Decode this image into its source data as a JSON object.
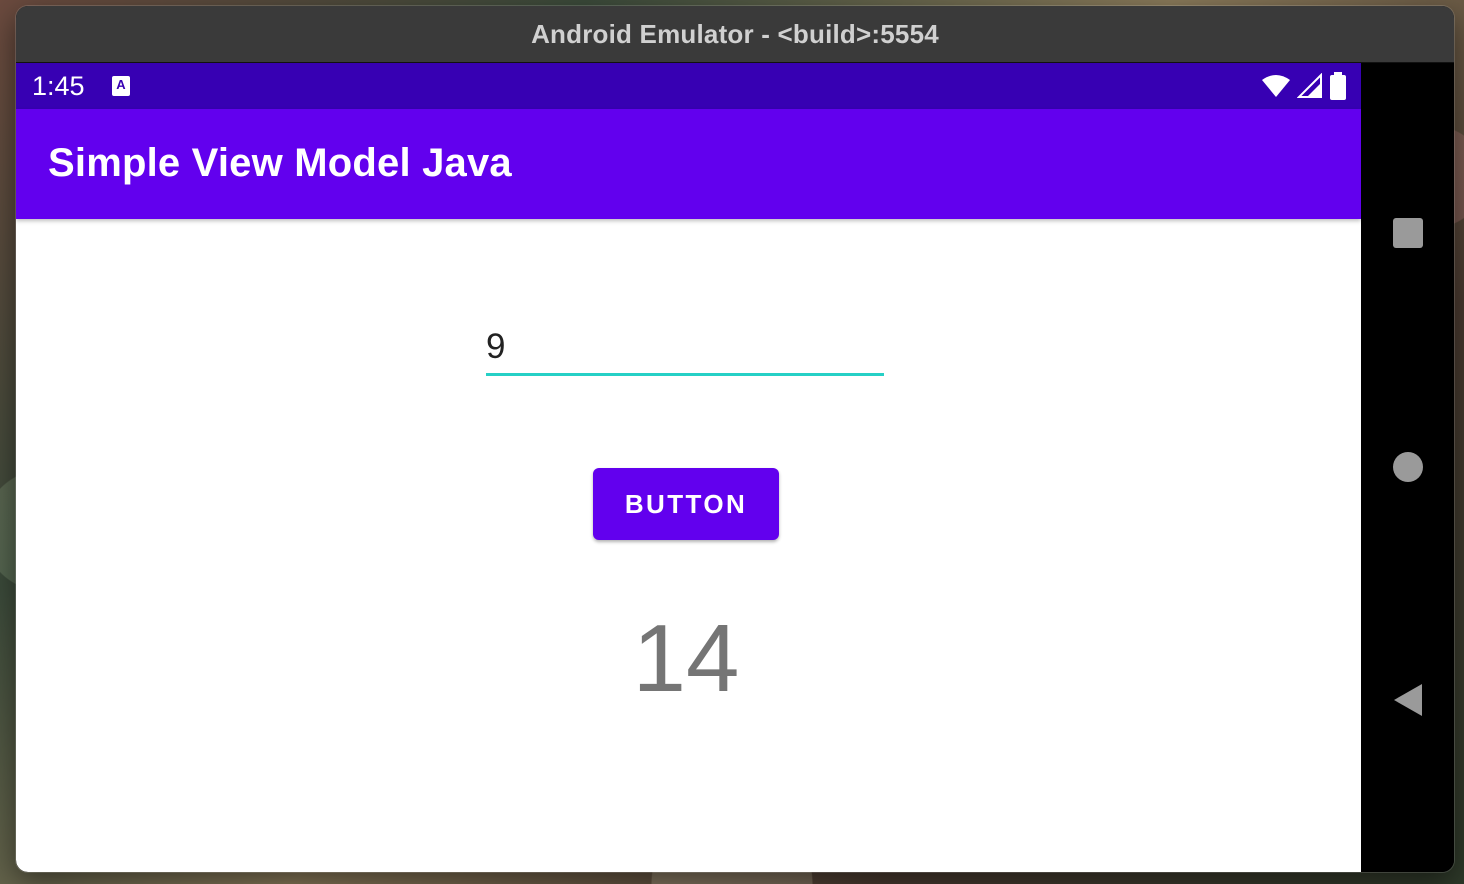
{
  "window": {
    "title": "Android Emulator - <build>:5554"
  },
  "status_bar": {
    "time": "1:45",
    "notification_icon": "accessibility-A-icon",
    "icons": [
      "wifi-icon",
      "cellular-signal-icon",
      "battery-icon"
    ]
  },
  "app_bar": {
    "title": "Simple View Model Java"
  },
  "form": {
    "input_value": "9",
    "button_label": "BUTTON",
    "result": "14"
  },
  "nav": {
    "buttons": [
      "recents-square-icon",
      "home-circle-icon",
      "back-triangle-icon"
    ]
  },
  "colors": {
    "status_bar": "#3700b3",
    "primary": "#6200ee",
    "input_underline": "#26d0c6",
    "result_text": "#757575"
  }
}
